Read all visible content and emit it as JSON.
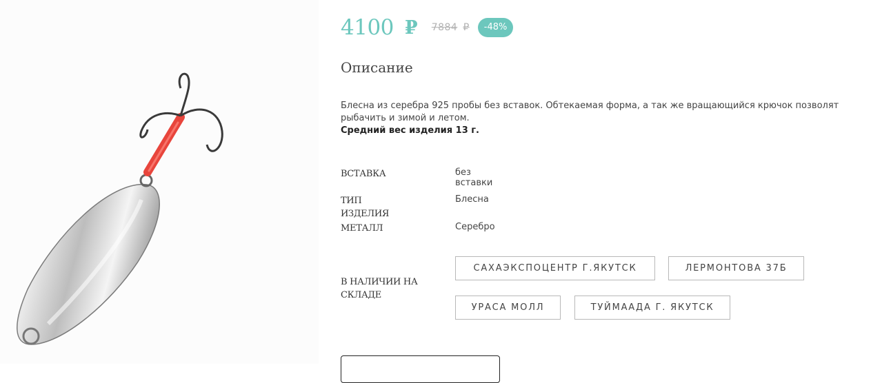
{
  "product_image": {
    "icon": "fishing-spoon-lure"
  },
  "price": {
    "current": "4100",
    "currency": "₽",
    "old": "7884",
    "old_currency": "₽",
    "discount": "-48%",
    "accent_color": "#6cc7bd"
  },
  "description": {
    "title": "Описание",
    "text": "Блесна из серебра 925 пробы без вставок. Обтекаемая форма, а так же вращающийся крючок позволят рыбачить и зимой и летом.",
    "weight": "Средний вес изделия 13 г."
  },
  "properties": [
    {
      "label": "ВСТАВКА",
      "value": "без вставки"
    },
    {
      "label": "ТИП ИЗДЕЛИЯ",
      "value": "Блесна"
    },
    {
      "label": "МЕТАЛЛ",
      "value": "Серебро"
    }
  ],
  "availability": {
    "label": "В НАЛИЧИИ НА СКЛАДЕ",
    "stores": [
      "САХАЭКСПОЦЕНТР Г.ЯКУТСК",
      "ЛЕРМОНТОВА 37Б",
      "УРАСА МОЛЛ",
      "ТУЙМААДА Г. ЯКУТСК"
    ]
  }
}
